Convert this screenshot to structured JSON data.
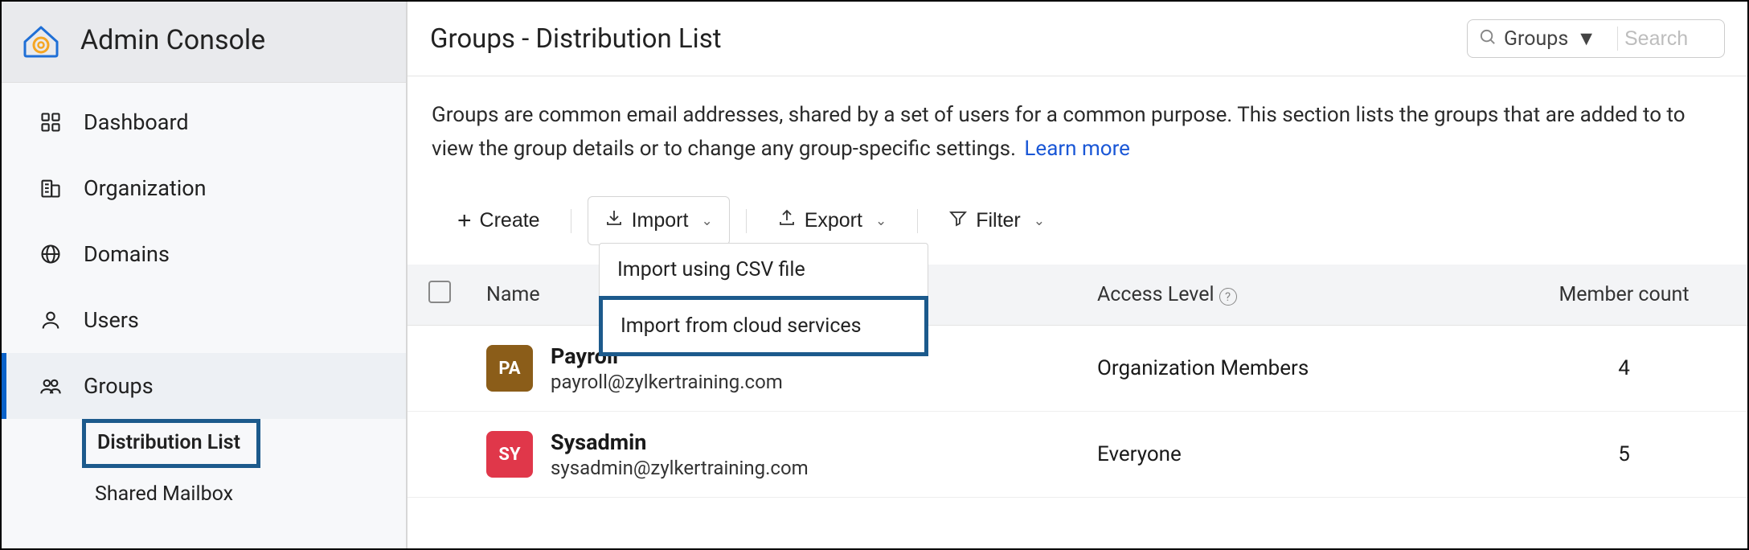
{
  "app": {
    "title": "Admin Console"
  },
  "sidebar": {
    "items": [
      {
        "label": "Dashboard"
      },
      {
        "label": "Organization"
      },
      {
        "label": "Domains"
      },
      {
        "label": "Users"
      },
      {
        "label": "Groups"
      }
    ],
    "sub": [
      {
        "label": "Distribution List"
      },
      {
        "label": "Shared Mailbox"
      }
    ]
  },
  "header": {
    "title": "Groups - Distribution List",
    "search_scope": "Groups",
    "search_placeholder": "Search"
  },
  "intro": {
    "text": "Groups are common email addresses, shared by a set of users for a common purpose. This section lists the groups that are added to to view the group details or to change any group-specific settings.",
    "learn_more": "Learn more"
  },
  "toolbar": {
    "create": "Create",
    "import": "Import",
    "export": "Export",
    "filter": "Filter"
  },
  "dropdown": {
    "items": [
      {
        "label": "Import using CSV file"
      },
      {
        "label": "Import from cloud services"
      }
    ]
  },
  "table": {
    "columns": {
      "name": "Name",
      "access": "Access Level",
      "count": "Member count"
    },
    "rows": [
      {
        "abbr": "PA",
        "color": "#8b5d19",
        "name": "Payroll",
        "email": "payroll@zylkertraining.com",
        "access": "Organization Members",
        "count": "4"
      },
      {
        "abbr": "SY",
        "color": "#e0374a",
        "name": "Sysadmin",
        "email": "sysadmin@zylkertraining.com",
        "access": "Everyone",
        "count": "5"
      }
    ]
  }
}
